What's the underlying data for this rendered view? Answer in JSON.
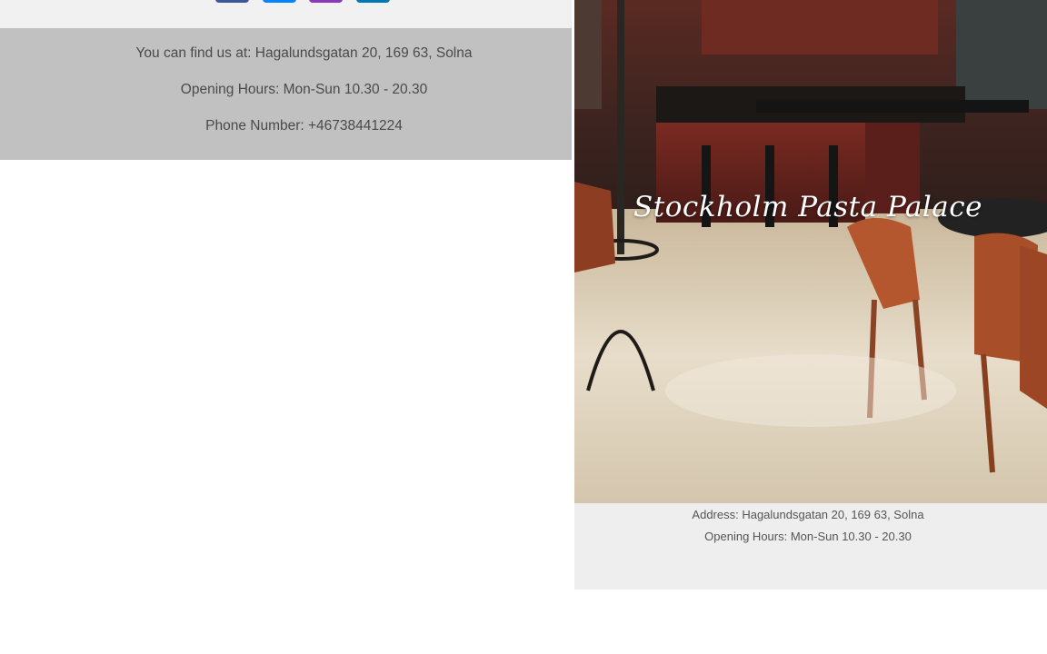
{
  "contact": {
    "address_line": "You can find us at: Hagalundsgatan 20, 169 63, Solna",
    "hours_line": "Opening Hours: Mon-Sun 10.30 - 20.30",
    "phone_line": "Phone Number: +46738441224"
  },
  "social": {
    "icons": [
      {
        "name": "facebook-icon",
        "color": "#3b5998"
      },
      {
        "name": "messenger-icon",
        "color": "#0084ff"
      },
      {
        "name": "instagram-icon",
        "color": "#8a3ab9"
      },
      {
        "name": "linkedin-icon",
        "color": "#0077b5"
      }
    ]
  },
  "card": {
    "title": "Stockholm Pasta Palace",
    "address": "Address: Hagalundsgatan 20, 169 63, Solna",
    "hours": "Opening Hours: Mon-Sun 10.30 - 20.30"
  },
  "colors": {
    "info_panel_bg": "#c1c1c1",
    "card_bg": "#eeeeee"
  }
}
